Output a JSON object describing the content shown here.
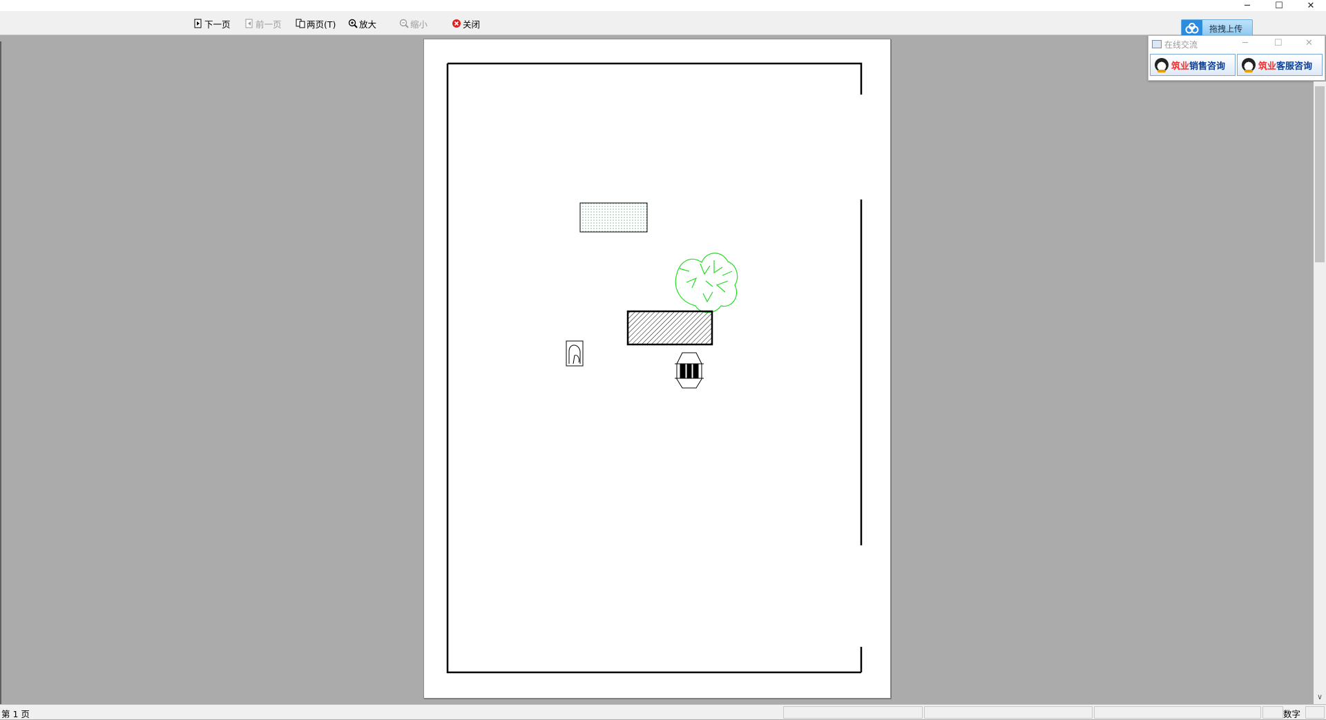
{
  "window": {
    "minimize_glyph": "─",
    "maximize_glyph": "☐",
    "close_glyph": "✕"
  },
  "toolbar": {
    "next_page": "下一页",
    "prev_page": "前一页",
    "two_pages": "两页(T)",
    "zoom_in": "放大",
    "zoom_out": "缩小",
    "close": "关闭"
  },
  "upload": {
    "label": "拖拽上传"
  },
  "chat": {
    "title": "在线交流",
    "sales": {
      "brand": "筑业",
      "text": "销售咨询"
    },
    "service": {
      "brand": "筑业",
      "text": "客服咨询"
    }
  },
  "statusbar": {
    "page_label": "第 1 页",
    "num_mode": "数字"
  },
  "colors": {
    "tree": "#22dd22",
    "hatch": "#000000",
    "dotted_fill": "#2e8b57"
  }
}
